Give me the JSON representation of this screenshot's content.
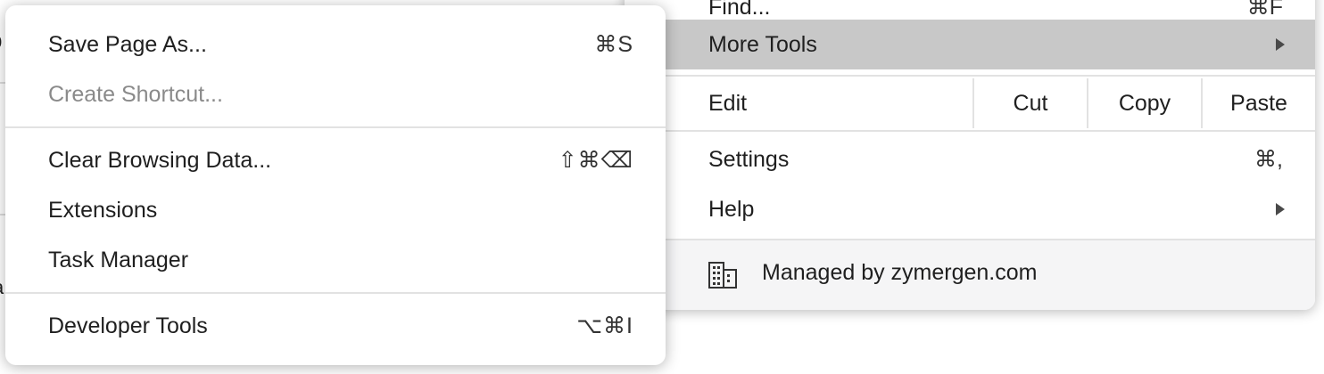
{
  "background": {
    "left_glyph_top": "p",
    "left_glyph_bottom": "a"
  },
  "main_menu": {
    "find": {
      "label": "Find...",
      "shortcut": "⌘F"
    },
    "more_tools": {
      "label": "More Tools"
    },
    "edit": {
      "label": "Edit",
      "cut": "Cut",
      "copy": "Copy",
      "paste": "Paste"
    },
    "settings": {
      "label": "Settings",
      "shortcut": "⌘,"
    },
    "help": {
      "label": "Help"
    },
    "managed": {
      "label": "Managed by zymergen.com"
    }
  },
  "sub_menu": {
    "save_page": {
      "label": "Save Page As...",
      "shortcut": "⌘S"
    },
    "create_shortcut": {
      "label": "Create Shortcut..."
    },
    "clear_browsing": {
      "label": "Clear Browsing Data...",
      "shortcut": "⇧⌘⌫"
    },
    "extensions": {
      "label": "Extensions"
    },
    "task_manager": {
      "label": "Task Manager"
    },
    "developer_tools": {
      "label": "Developer Tools",
      "shortcut": "⌥⌘I"
    }
  },
  "colors": {
    "highlight": "#c8c8c8",
    "disabled_text": "#8a8a8a",
    "separator": "#e2e2e2",
    "managed_bg": "#f5f5f6"
  },
  "icons": {
    "submenu_arrow": "triangle-right",
    "managed": "building-icon"
  }
}
